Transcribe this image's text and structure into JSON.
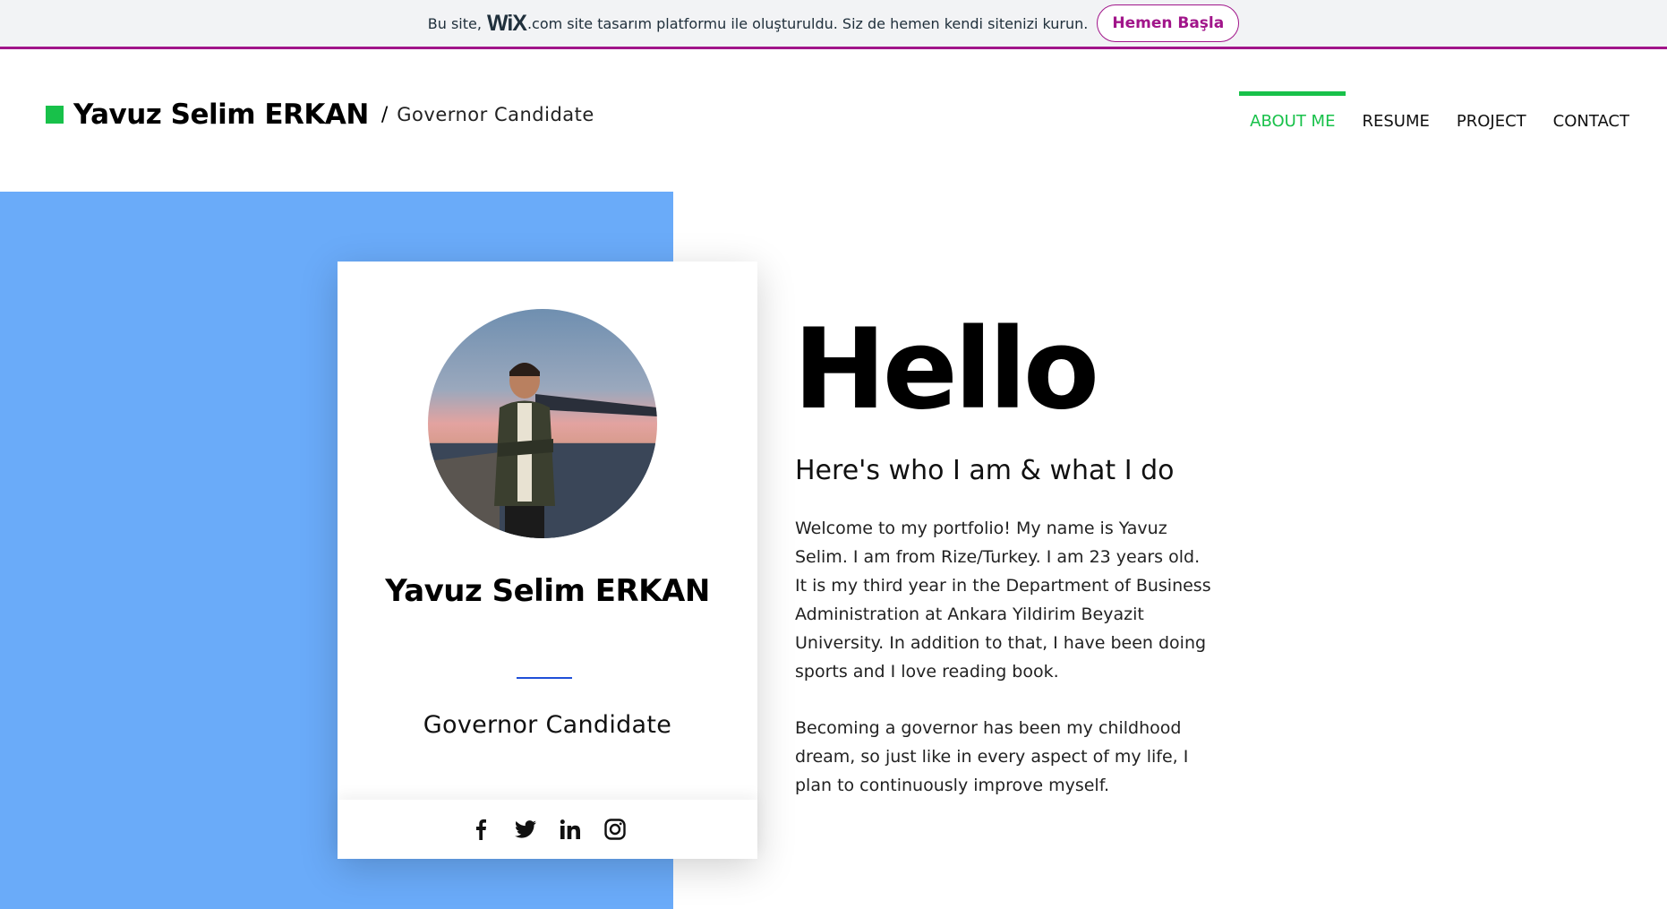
{
  "wix_banner": {
    "text_before": "Bu site,",
    "logo": "WiX",
    "logo_suffix": ".com",
    "text_after": "site tasarım platformu ile oluşturuldu. Siz de hemen kendi sitenizi kurun.",
    "cta_label": "Hemen Başla",
    "accent_color": "#a1158a"
  },
  "header": {
    "name": "Yavuz Selim ERKAN",
    "separator": "/",
    "role": "Governor Candidate",
    "brand_color": "#18c14a"
  },
  "nav": {
    "items": [
      {
        "label": "ABOUT ME",
        "active": true
      },
      {
        "label": "RESUME",
        "active": false
      },
      {
        "label": "PROJECT",
        "active": false
      },
      {
        "label": "CONTACT",
        "active": false
      }
    ]
  },
  "profile_card": {
    "name": "Yavuz Selim ERKAN",
    "role": "Governor Candidate",
    "photo_icon": "profile-photo",
    "socials": [
      "facebook-icon",
      "twitter-icon",
      "linkedin-icon",
      "instagram-icon"
    ]
  },
  "hero": {
    "heading": "Hello",
    "subtitle": "Here's who I am & what I do",
    "paragraph_1": "Welcome to my portfolio! My name is Yavuz Selim. I am from Rize/Turkey. I am 23 years old. It is my third year in the Department of Business Administration at Ankara Yildirim Beyazit University. In addition to that, I have been doing sports and I love reading book.",
    "paragraph_2": "Becoming a governor has been my childhood dream, so just like in every aspect of my life, I plan to continuously improve myself.",
    "block_color": "#6aabf9"
  }
}
